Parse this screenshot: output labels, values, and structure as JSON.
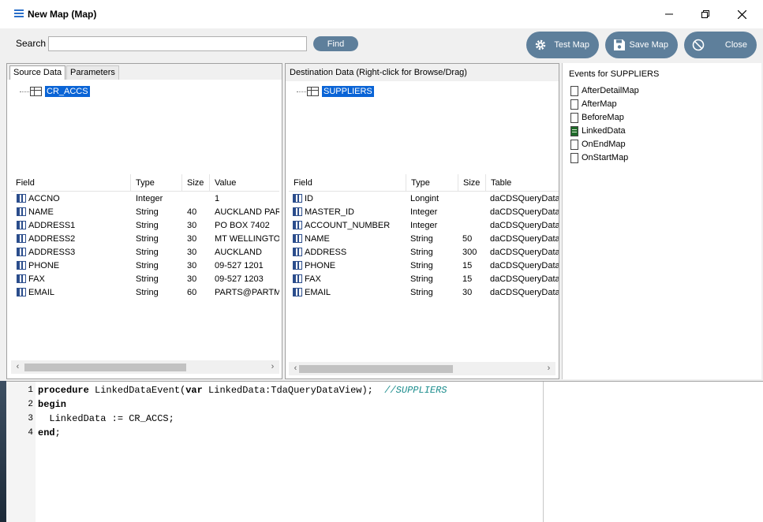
{
  "window": {
    "title": "New Map (Map)"
  },
  "toolbar": {
    "search_label": "Search",
    "search_value": "",
    "find_label": "Find",
    "test_map_label": "Test Map",
    "save_map_label": "Save Map",
    "close_label": "Close"
  },
  "source": {
    "tabs": [
      "Source Data",
      "Parameters"
    ],
    "tree_node": "CR_ACCS",
    "columns": [
      "Field",
      "Type",
      "Size",
      "Value"
    ],
    "rows": [
      [
        "ACCNO",
        "Integer",
        "",
        "1"
      ],
      [
        "NAME",
        "String",
        "40",
        "AUCKLAND PAR."
      ],
      [
        "ADDRESS1",
        "String",
        "30",
        "PO BOX 7402"
      ],
      [
        "ADDRESS2",
        "String",
        "30",
        "MT WELLINGTON"
      ],
      [
        "ADDRESS3",
        "String",
        "30",
        "AUCKLAND"
      ],
      [
        "PHONE",
        "String",
        "30",
        "09-527 1201"
      ],
      [
        "FAX",
        "String",
        "30",
        "09-527 1203"
      ],
      [
        "EMAIL",
        "String",
        "60",
        "PARTS@PARTM."
      ]
    ]
  },
  "destination": {
    "header": "Destination Data   (Right-click for Browse/Drag)",
    "tree_node": "SUPPLIERS",
    "columns": [
      "Field",
      "Type",
      "Size",
      "Table"
    ],
    "rows": [
      [
        "ID",
        "Longint",
        "",
        "daCDSQueryData"
      ],
      [
        "MASTER_ID",
        "Integer",
        "",
        "daCDSQueryData"
      ],
      [
        "ACCOUNT_NUMBER",
        "Integer",
        "",
        "daCDSQueryData"
      ],
      [
        "NAME",
        "String",
        "50",
        "daCDSQueryData"
      ],
      [
        "ADDRESS",
        "String",
        "300",
        "daCDSQueryData"
      ],
      [
        "PHONE",
        "String",
        "15",
        "daCDSQueryData"
      ],
      [
        "FAX",
        "String",
        "15",
        "daCDSQueryData"
      ],
      [
        "EMAIL",
        "String",
        "30",
        "daCDSQueryData"
      ]
    ]
  },
  "events": {
    "title": "Events for SUPPLIERS",
    "items": [
      {
        "label": "AfterDetailMap",
        "icon": "document-icon"
      },
      {
        "label": "AfterMap",
        "icon": "document-icon"
      },
      {
        "label": "BeforeMap",
        "icon": "document-icon"
      },
      {
        "label": "LinkedData",
        "icon": "document-filled-icon"
      },
      {
        "label": "OnEndMap",
        "icon": "document-icon"
      },
      {
        "label": "OnStartMap",
        "icon": "document-icon"
      }
    ]
  },
  "code": {
    "line_numbers": [
      "1",
      "2",
      "3",
      "4"
    ],
    "line1_kw1": "procedure",
    "line1_text": " LinkedDataEvent(",
    "line1_kw2": "var",
    "line1_text2": " LinkedData:TdaQueryDataView);  ",
    "line1_comment": "//SUPPLIERS",
    "line2_kw": "begin",
    "line3_text": "  LinkedData := CR_ACCS;",
    "line4_kw": "end",
    "line4_text": ";"
  }
}
